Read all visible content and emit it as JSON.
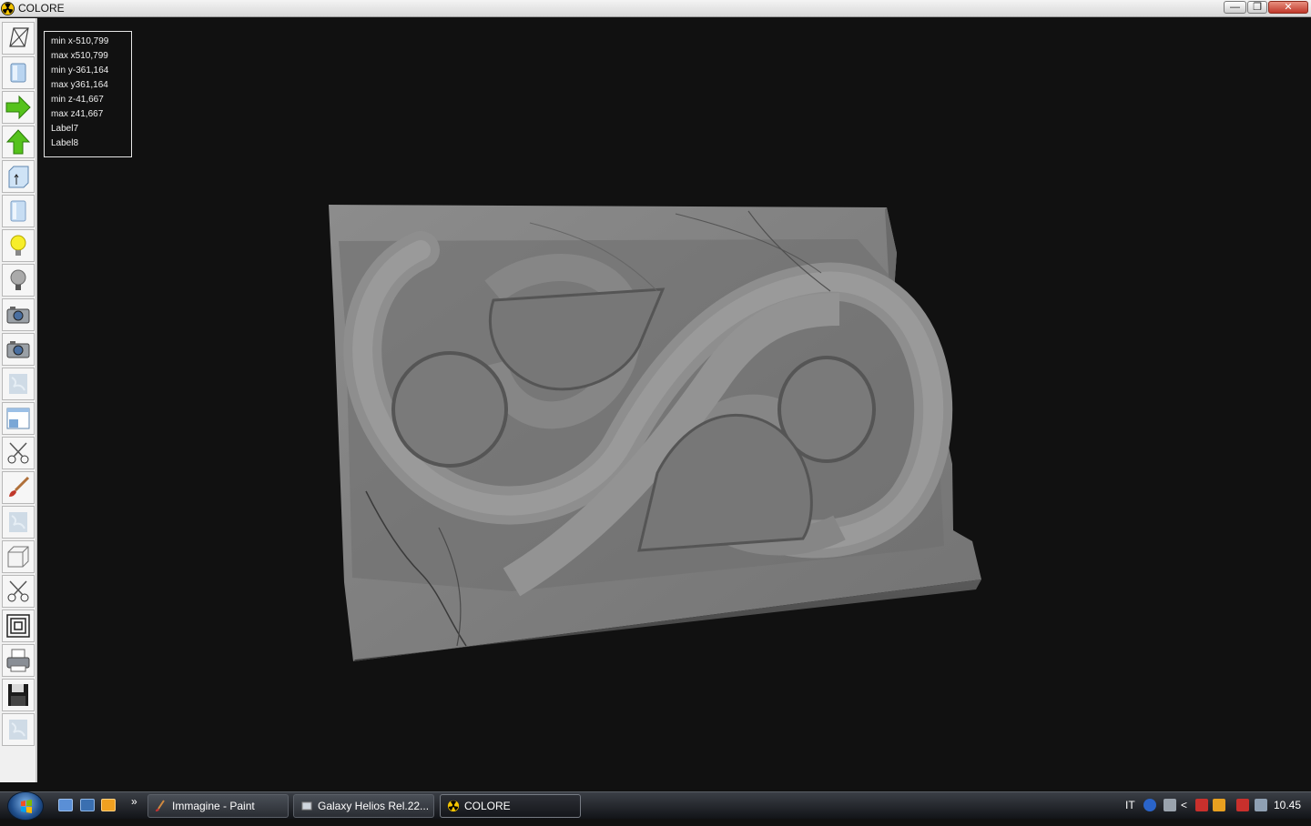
{
  "window": {
    "title": "COLORE",
    "buttons": {
      "minimize": "—",
      "restore": "❐",
      "close": "✕"
    }
  },
  "toolbar": {
    "tools": [
      {
        "name": "wireframe-icon"
      },
      {
        "name": "solid-view-icon"
      },
      {
        "name": "arrow-right-icon"
      },
      {
        "name": "arrow-up-icon"
      },
      {
        "name": "box-arrow-icon"
      },
      {
        "name": "cylinder-icon"
      },
      {
        "name": "light-on-icon"
      },
      {
        "name": "light-off-icon"
      },
      {
        "name": "camera-icon"
      },
      {
        "name": "camera-2-icon"
      },
      {
        "name": "texture-icon"
      },
      {
        "name": "window-view-icon"
      },
      {
        "name": "scissors-icon"
      },
      {
        "name": "brush-icon"
      },
      {
        "name": "texture-2-icon"
      },
      {
        "name": "cube-icon"
      },
      {
        "name": "scissors-2-icon"
      },
      {
        "name": "spiral-icon"
      },
      {
        "name": "printer-icon"
      },
      {
        "name": "save-icon"
      },
      {
        "name": "texture-3-icon"
      }
    ]
  },
  "info": {
    "min_x": "min x-510,799",
    "max_x": "max x510,799",
    "min_y": "min y-361,164",
    "max_y": "max y361,164",
    "min_z": "min z-41,667",
    "max_z": "max z41,667",
    "label7": "Label7",
    "label8": "Label8"
  },
  "taskbar": {
    "more": "»",
    "tasks": [
      {
        "label": "Immagine - Paint"
      },
      {
        "label": "Galaxy Helios  Rel.22..."
      },
      {
        "label": "COLORE"
      }
    ],
    "tray": {
      "language": "IT",
      "clock": "10.45",
      "arrow": "<"
    }
  }
}
